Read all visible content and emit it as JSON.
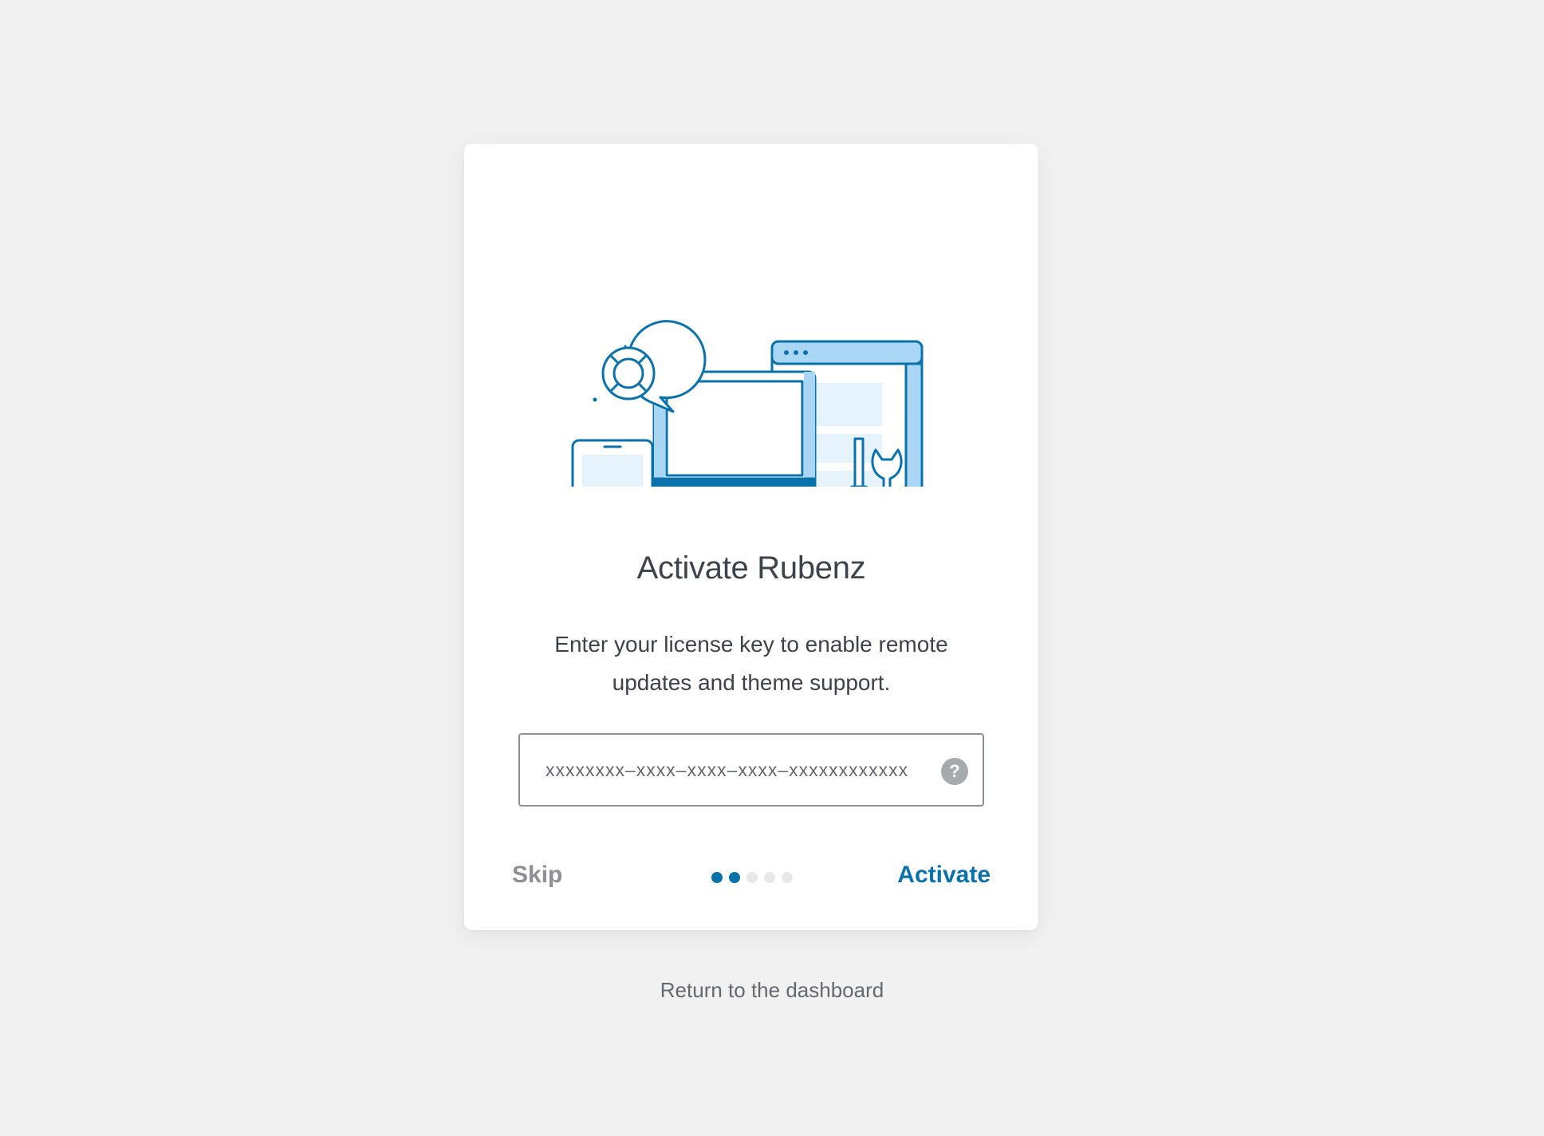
{
  "card": {
    "title": "Activate Rubenz",
    "description": "Enter your license key to enable remote updates and theme support.",
    "license_field": {
      "value": "",
      "placeholder": "xxxxxxxx–xxxx–xxxx–xxxx–xxxxxxxxxxxx"
    },
    "help_icon_glyph": "?",
    "skip_label": "Skip",
    "activate_label": "Activate",
    "steps": {
      "total": 5,
      "current": 2
    }
  },
  "return_link": "Return to the dashboard",
  "colors": {
    "accent": "#0a72aa",
    "light_accent": "#a9d6f5",
    "background": "#f1f1f1",
    "muted": "#8c8f94"
  },
  "icons": {
    "illustration": "support-tools-illustration",
    "help": "help-question-icon"
  }
}
